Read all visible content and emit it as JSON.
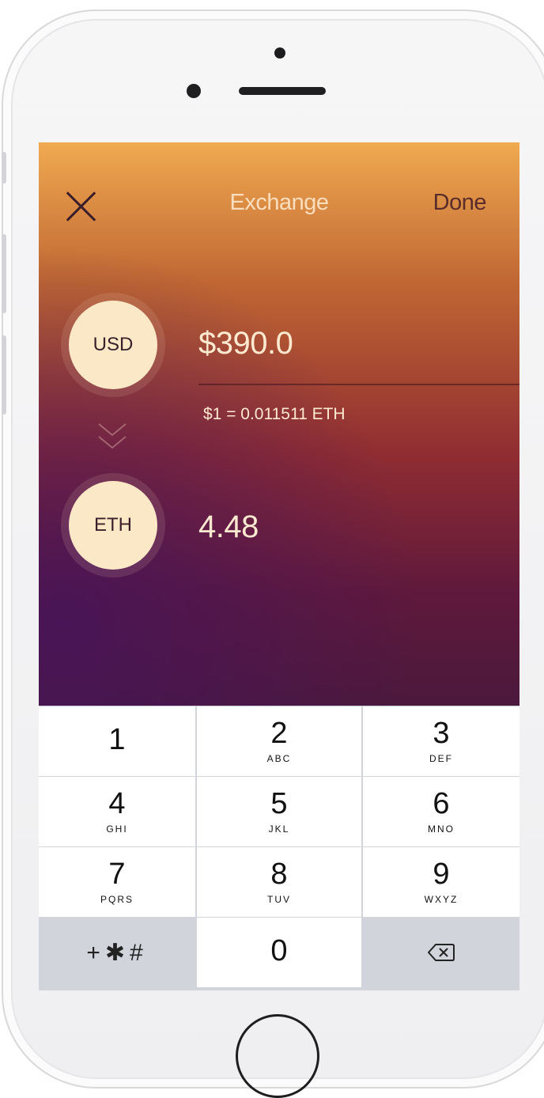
{
  "header": {
    "title": "Exchange",
    "done_label": "Done"
  },
  "from": {
    "currency": "USD",
    "amount": "$390.0"
  },
  "rate_text": "$1 = 0.011511 ETH",
  "to": {
    "currency": "ETH",
    "amount": "4.48"
  },
  "keypad": {
    "keys": [
      {
        "digit": "1",
        "letters": ""
      },
      {
        "digit": "2",
        "letters": "ABC"
      },
      {
        "digit": "3",
        "letters": "DEF"
      },
      {
        "digit": "4",
        "letters": "GHI"
      },
      {
        "digit": "5",
        "letters": "JKL"
      },
      {
        "digit": "6",
        "letters": "MNO"
      },
      {
        "digit": "7",
        "letters": "PQRS"
      },
      {
        "digit": "8",
        "letters": "TUV"
      },
      {
        "digit": "9",
        "letters": "WXYZ"
      }
    ],
    "symbols_label": "+✱#",
    "zero": "0",
    "backspace_icon": "delete-backspace-icon"
  },
  "colors": {
    "gradient_top": "#f0aa50",
    "gradient_bottom": "#4b193c",
    "coin_fill": "#fbe8c6",
    "amount_text": "#fde9cf"
  }
}
